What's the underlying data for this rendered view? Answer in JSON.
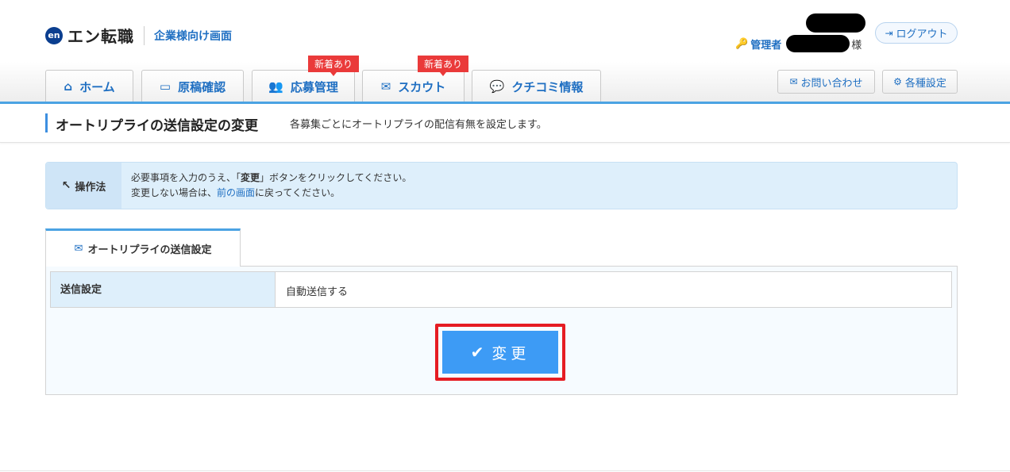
{
  "header": {
    "logo_mark": "en",
    "logo_text": "エン転職",
    "logo_sub": "企業様向け画面",
    "user_label": "管理者",
    "user_suffix": "様",
    "logout_label": "ログアウト"
  },
  "tabs": [
    {
      "label": "ホーム",
      "icon": "home-icon"
    },
    {
      "label": "原稿確認",
      "icon": "inbox-icon"
    },
    {
      "label": "応募管理",
      "icon": "users-icon",
      "badge": "新着あり"
    },
    {
      "label": "スカウト",
      "icon": "envelope-icon",
      "badge": "新着あり"
    },
    {
      "label": "クチコミ情報",
      "icon": "comment-icon"
    }
  ],
  "right_buttons": {
    "contact": "お問い合わせ",
    "settings": "各種設定"
  },
  "page": {
    "title": "オートリプライの送信設定の変更",
    "description": "各募集ごとにオートリプライの配信有無を設定します。"
  },
  "instructions": {
    "label": "操作法",
    "line1_pre": "必要事項を入力のうえ、「",
    "line1_bold": "変更",
    "line1_post": "」ボタンをクリックしてください。",
    "line2_pre": "変更しない場合は、",
    "line2_link": "前の画面",
    "line2_post": "に戻ってください。"
  },
  "panel": {
    "tab_label": "オートリプライの送信設定",
    "row_label": "送信設定",
    "row_value": "自動送信する",
    "submit_label": "変更"
  },
  "colors": {
    "accent": "#1f6fc2",
    "tab_line": "#4ba3e3",
    "badge": "#ea3a3a",
    "submit": "#3d9bf5",
    "highlight": "#e51c23"
  }
}
